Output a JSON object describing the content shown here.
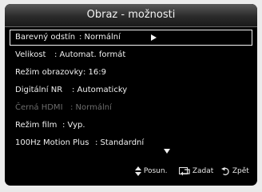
{
  "menu": {
    "title": "Obraz - možnosti",
    "items": [
      {
        "label": "Barevný odstín",
        "value": ": Normální"
      },
      {
        "label": "Velikost",
        "value": ": Automat. formát"
      },
      {
        "label": "Režim obrazovky",
        "value": ": 16:9"
      },
      {
        "label": "Digitální NR",
        "value": ": Automaticky"
      },
      {
        "label": "Černá HDMI",
        "value": ": Normální"
      },
      {
        "label": "Režim film",
        "value": ": Vyp."
      },
      {
        "label": "100Hz Motion Plus",
        "value": ": Standardní"
      }
    ]
  },
  "help": {
    "move": "Posun.",
    "enter": "Zadat",
    "back": "Zpět"
  },
  "icons": {
    "selected_arrow": "arrow-right-icon",
    "scroll": "scroll-down-icon",
    "move": "up-down-icon",
    "enter": "enter-icon",
    "back": "return-icon"
  },
  "colors": {
    "panel_bg": "#000000",
    "text": "#f0f0f0",
    "disabled_text": "#6c6c6c",
    "highlight_border": "#f5f5f5"
  }
}
